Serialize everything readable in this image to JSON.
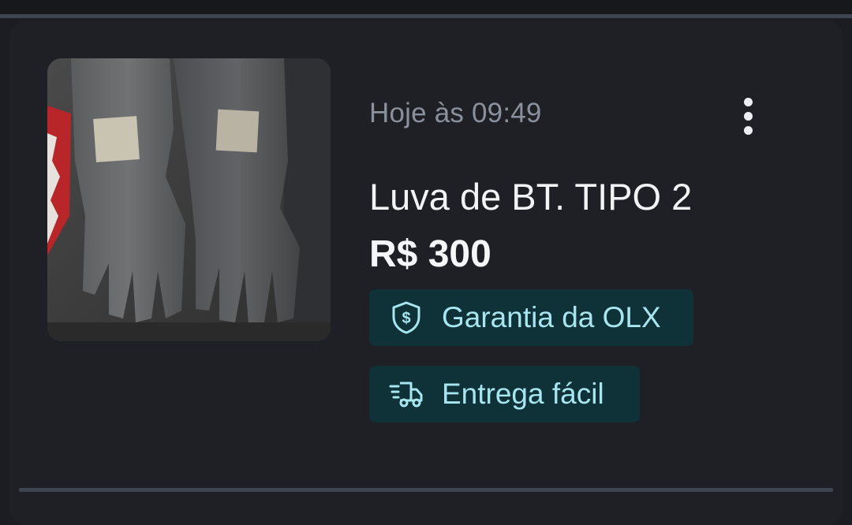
{
  "listing": {
    "timestamp": "Hoje às 09:49",
    "title": "Luva de BT. TIPO 2",
    "price": "R$ 300",
    "image_subject": "pair of rubber insulating gloves",
    "badges": [
      {
        "label": "Garantia da OLX",
        "icon": "shield-dollar-icon"
      },
      {
        "label": "Entrega fácil",
        "icon": "delivery-truck-icon"
      }
    ],
    "menu_icon": "more-vertical-icon"
  },
  "colors": {
    "background": "#1c1d22",
    "card": "#1f2025",
    "divider": "#3f4550",
    "badge_bg": "#0f3138",
    "badge_text": "#a7e5ef",
    "muted_text": "#8b919c",
    "primary_text": "#f2f3f5"
  }
}
